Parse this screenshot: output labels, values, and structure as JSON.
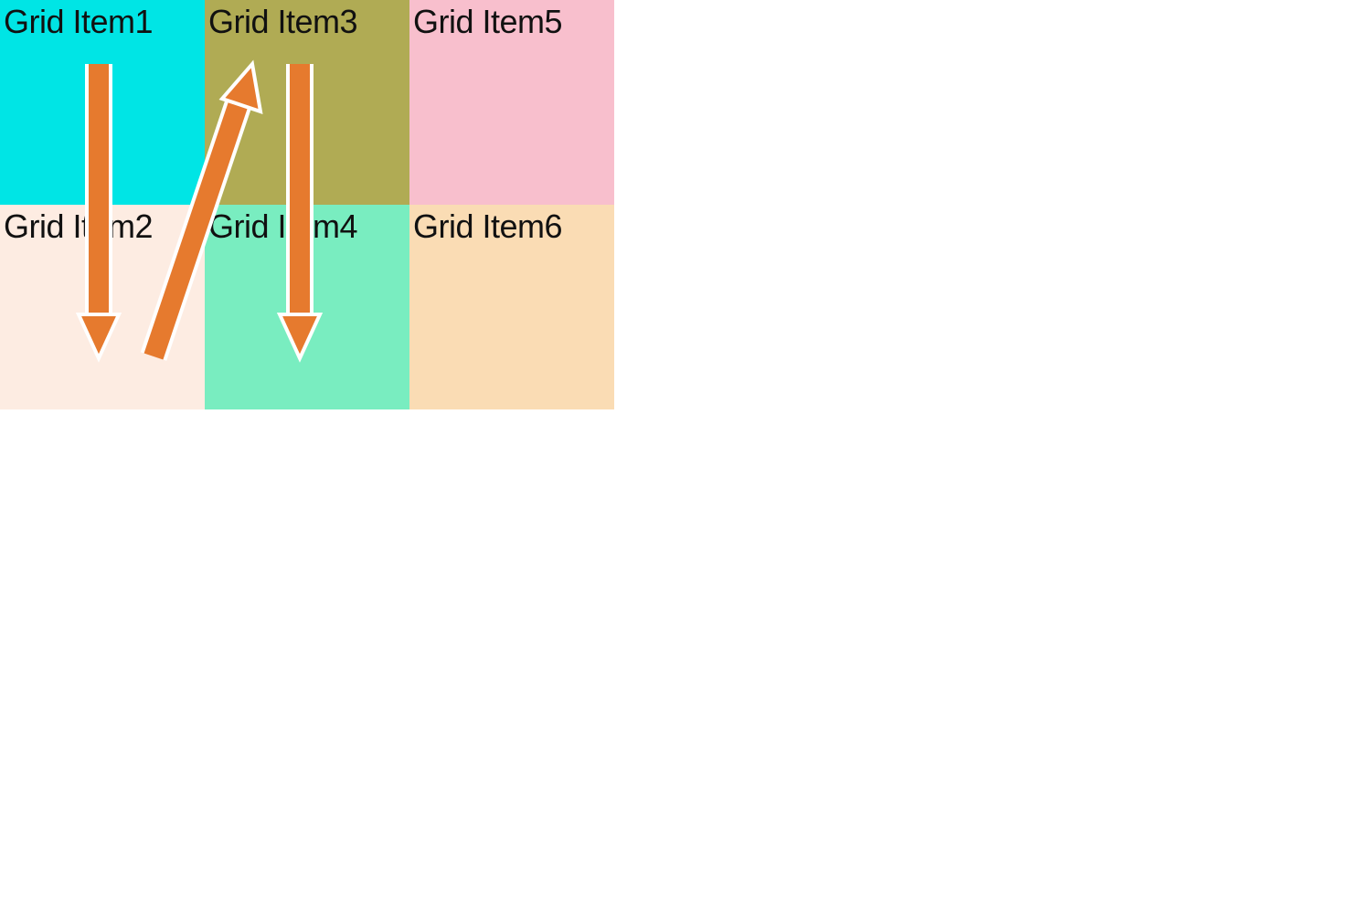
{
  "grid": {
    "items": [
      {
        "label": "Grid Item1",
        "color": "#00e5e5"
      },
      {
        "label": "Grid Item2",
        "color": "#fdece2"
      },
      {
        "label": "Grid Item3",
        "color": "#b0ab54"
      },
      {
        "label": "Grid Item4",
        "color": "#79edc0"
      },
      {
        "label": "Grid Item5",
        "color": "#f8bfcd"
      },
      {
        "label": "Grid Item6",
        "color": "#fadcb4"
      }
    ]
  },
  "arrows": {
    "color": "#e67a2e",
    "outline": "#ffffff",
    "paths": [
      {
        "from": "cell-1",
        "to": "cell-2",
        "direction": "down"
      },
      {
        "from": "cell-2",
        "to": "cell-3",
        "direction": "diagonal-up-right"
      },
      {
        "from": "cell-3",
        "to": "cell-4",
        "direction": "down"
      }
    ]
  }
}
